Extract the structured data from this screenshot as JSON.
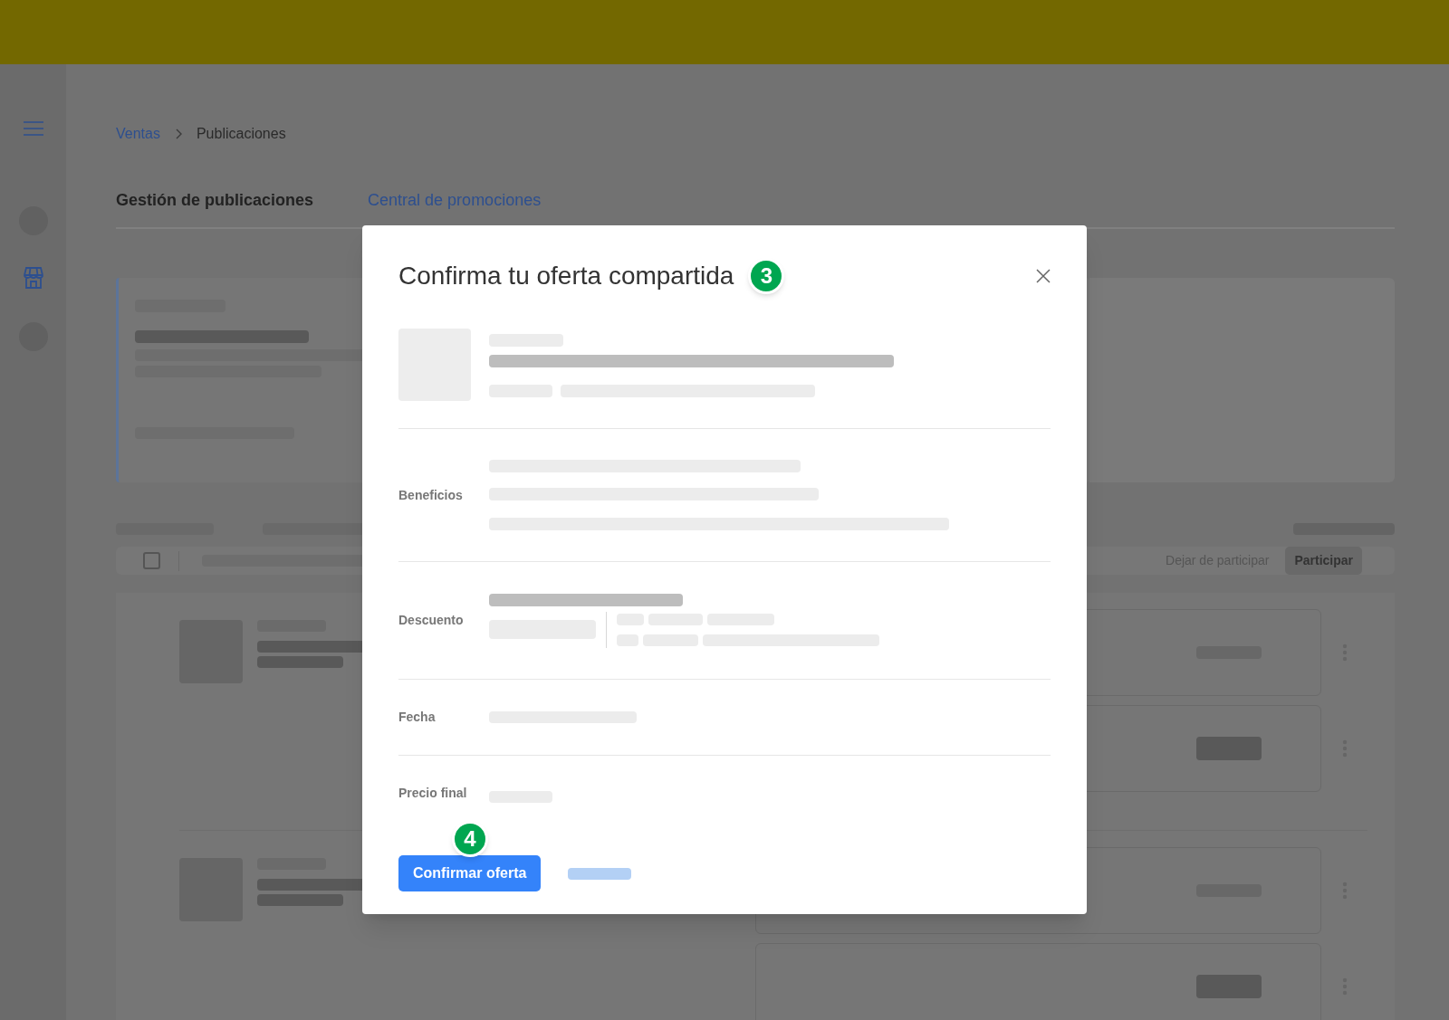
{
  "breadcrumb": [
    {
      "label": "Ventas",
      "kind": "link"
    },
    {
      "label": "Publicaciones",
      "kind": "current"
    }
  ],
  "tabs": [
    {
      "label": "Gestión de publicaciones",
      "selected": false
    },
    {
      "label": "Central de promociones",
      "selected": true
    }
  ],
  "toolbar": {
    "secondary_action": "Dejar de participar",
    "primary_action": "Participar",
    "select_all_checked": false
  },
  "modal": {
    "title": "Confirma tu oferta compartida",
    "title_marker": "3",
    "rows": [
      {
        "label": "Beneficios",
        "kind": "benefits"
      },
      {
        "label": "Descuento",
        "kind": "discount"
      },
      {
        "label": "Fecha",
        "kind": "date"
      },
      {
        "label": "Precio final",
        "kind": "price"
      }
    ],
    "confirm_button": "Confirmar oferta",
    "button_marker": "4"
  }
}
